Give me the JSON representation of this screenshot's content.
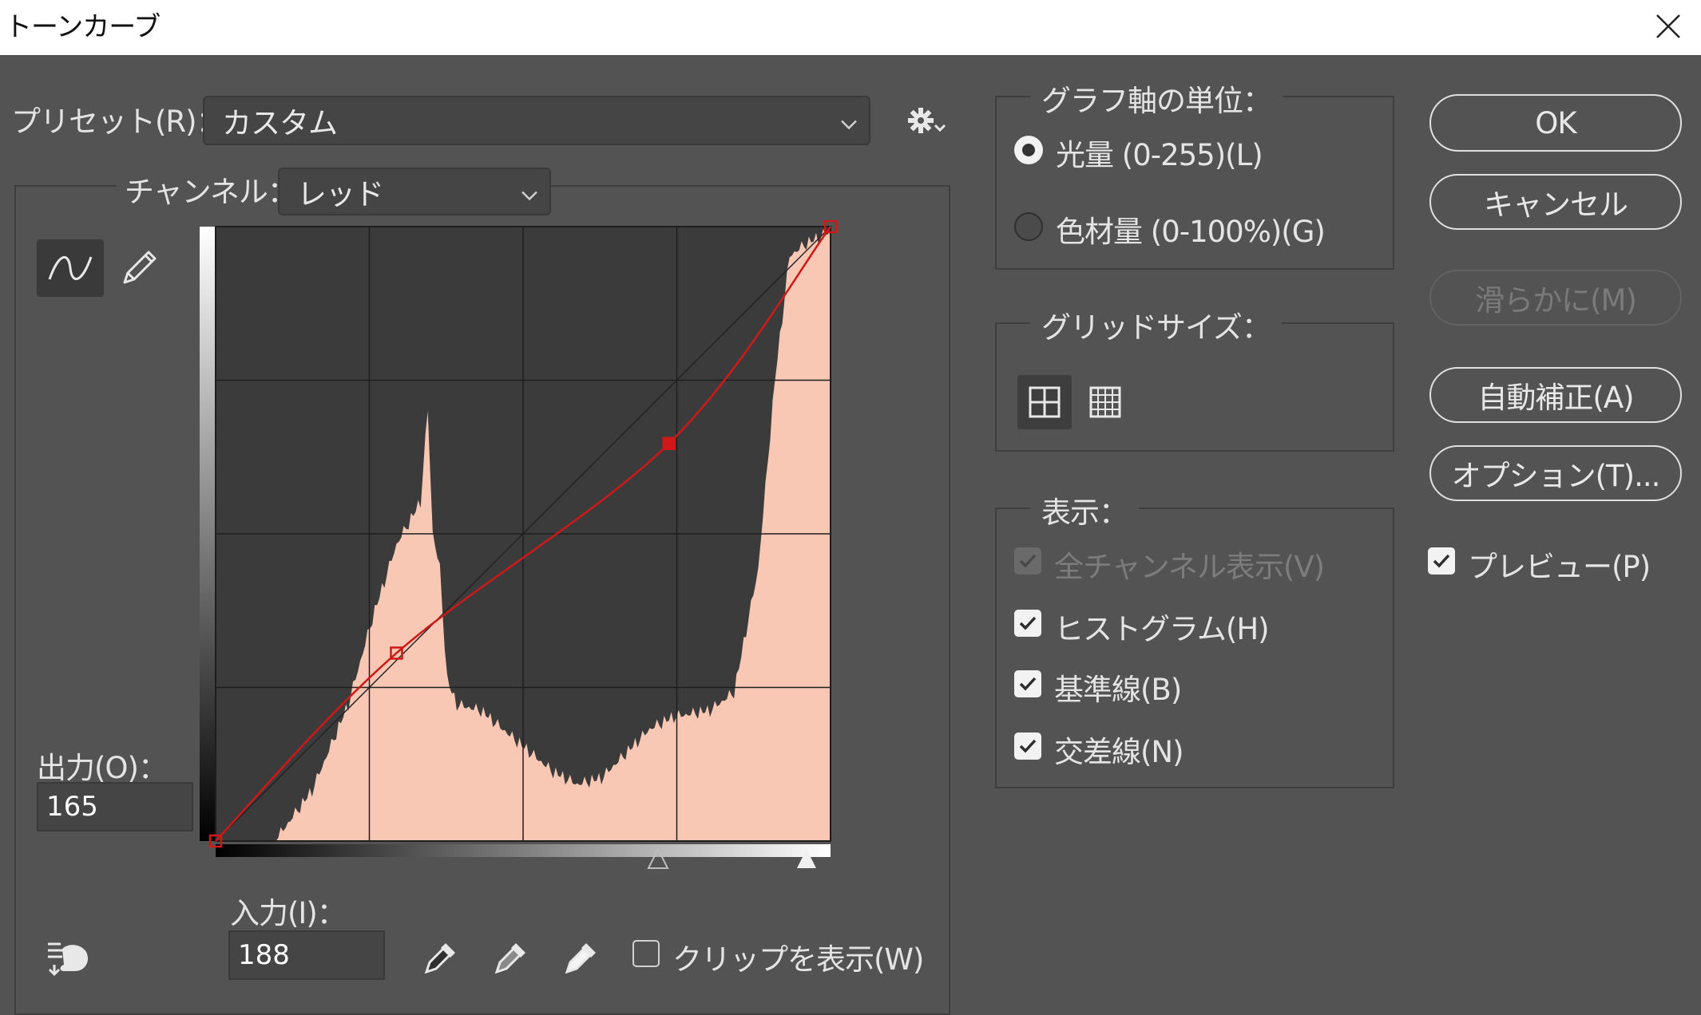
{
  "window": {
    "title": "トーンカーブ"
  },
  "preset": {
    "label": "プリセット(R)：",
    "value": "カスタム"
  },
  "channel": {
    "label": "チャンネル：",
    "value": "レッド"
  },
  "output": {
    "label": "出力(O)：",
    "value": "165"
  },
  "input": {
    "label": "入力(I)：",
    "value": "188"
  },
  "clip": {
    "label": "クリップを表示(W)",
    "checked": false
  },
  "axis_group": {
    "legend": "グラフ軸の単位：",
    "options": [
      {
        "label": "光量 (0-255)(L)",
        "selected": true
      },
      {
        "label": "色材量 (0-100%)(G)",
        "selected": false
      }
    ]
  },
  "grid_group": {
    "legend": "グリッドサイズ："
  },
  "display_group": {
    "legend": "表示：",
    "items": [
      {
        "label": "全チャンネル表示(V)",
        "checked": true,
        "disabled": true
      },
      {
        "label": "ヒストグラム(H)",
        "checked": true,
        "disabled": false
      },
      {
        "label": "基準線(B)",
        "checked": true,
        "disabled": false
      },
      {
        "label": "交差線(N)",
        "checked": true,
        "disabled": false
      }
    ]
  },
  "buttons": {
    "ok": "OK",
    "cancel": "キャンセル",
    "smooth": "滑らかに(M)",
    "auto": "自動補正(A)",
    "options": "オプション(T)..."
  },
  "preview": {
    "label": "プレビュー(P)",
    "checked": true
  },
  "colors": {
    "background": "#535353",
    "histogram": "#f8c8b4",
    "curve": "#d01818",
    "graph_bg": "#3b3b3b"
  },
  "curve_points": [
    {
      "input": 0,
      "output": 0
    },
    {
      "input": 75,
      "output": 78
    },
    {
      "input": 188,
      "output": 165
    },
    {
      "input": 255,
      "output": 255
    }
  ],
  "selected_point_index": 2
}
